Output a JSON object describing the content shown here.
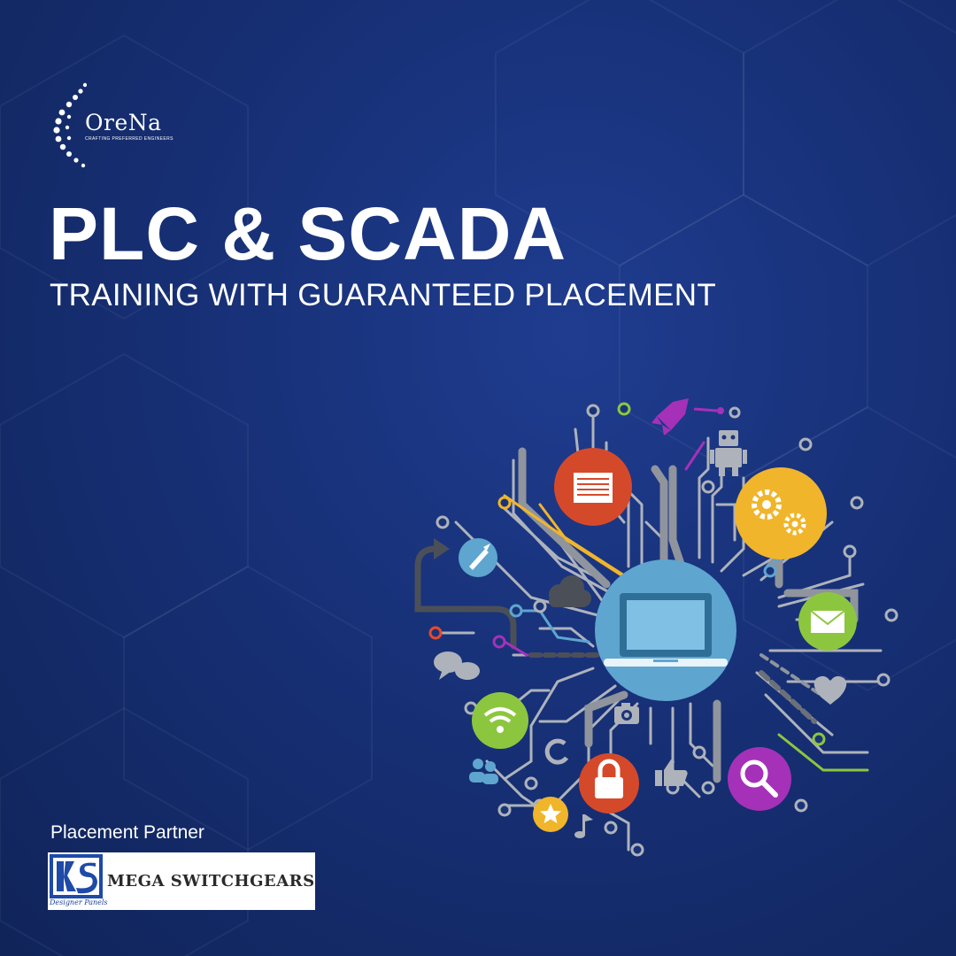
{
  "brand": {
    "name": "OreNa",
    "tagline": "CRAFTING PREFERRED ENGINEERS"
  },
  "headline": {
    "title": "PLC & SCADA",
    "subtitle": "TRAINING WITH GUARANTEED PLACEMENT"
  },
  "partner": {
    "label": "Placement Partner",
    "name": "MEGA SWITCHGEARS",
    "mark_tag": "Designer Panels"
  },
  "colors": {
    "background": "#173076",
    "text": "#ffffff",
    "red": "#d5492b",
    "yellow": "#f0b52b",
    "green": "#8cc63f",
    "purple": "#a531b8",
    "blue": "#5ea5cf",
    "gray": "#9b9fa8"
  },
  "icons": [
    "document-icon",
    "gears-icon",
    "rocket-icon",
    "laptop-icon",
    "mail-icon",
    "wifi-icon",
    "lock-icon",
    "search-icon",
    "star-icon",
    "robot-icon",
    "cloud-icon",
    "chat-icon",
    "heart-icon",
    "camera-icon",
    "thumbs-up-icon",
    "users-icon",
    "music-note-icon",
    "refresh-icon"
  ]
}
